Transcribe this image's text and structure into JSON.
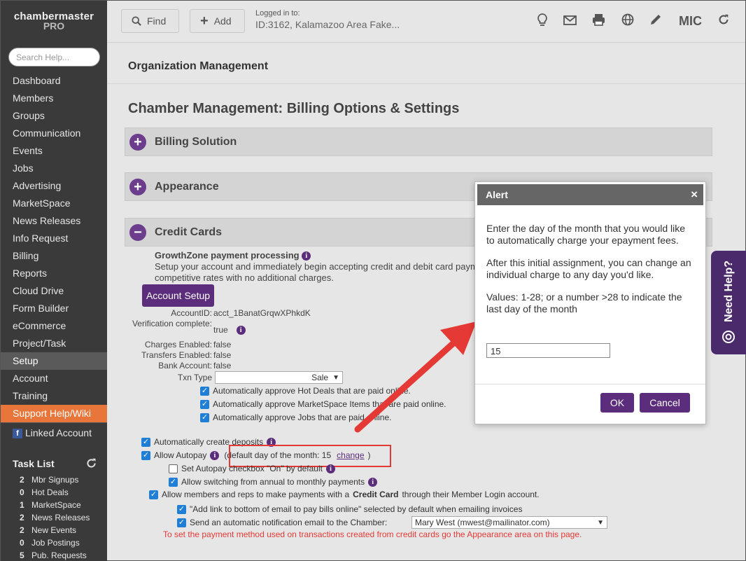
{
  "sidebar": {
    "logo_line1": "chambermaster",
    "logo_line2": "PRO",
    "search_placeholder": "Search Help...",
    "items": [
      {
        "label": "Dashboard"
      },
      {
        "label": "Members"
      },
      {
        "label": "Groups"
      },
      {
        "label": "Communication"
      },
      {
        "label": "Events"
      },
      {
        "label": "Jobs"
      },
      {
        "label": "Advertising"
      },
      {
        "label": "MarketSpace"
      },
      {
        "label": "News Releases"
      },
      {
        "label": "Info Request"
      },
      {
        "label": "Billing"
      },
      {
        "label": "Reports"
      },
      {
        "label": "Cloud Drive"
      },
      {
        "label": "Form Builder"
      },
      {
        "label": "eCommerce"
      },
      {
        "label": "Project/Task"
      },
      {
        "label": "Setup"
      },
      {
        "label": "Account"
      },
      {
        "label": "Training"
      },
      {
        "label": "Support Help/Wiki"
      }
    ],
    "linked_account": "Linked Account",
    "task_list_title": "Task List",
    "tasks": [
      {
        "count": "2",
        "label": "Mbr Signups"
      },
      {
        "count": "0",
        "label": "Hot Deals"
      },
      {
        "count": "1",
        "label": "MarketSpace"
      },
      {
        "count": "2",
        "label": "News Releases"
      },
      {
        "count": "2",
        "label": "New Events"
      },
      {
        "count": "0",
        "label": "Job Postings"
      },
      {
        "count": "5",
        "label": "Pub. Requests"
      }
    ]
  },
  "topbar": {
    "find_label": "Find",
    "add_label": "Add",
    "logged_in_label": "Logged in to:",
    "logged_in_value": "ID:3162, Kalamazoo Area Fake...",
    "mic_label": "MIC"
  },
  "main": {
    "org_title": "Organization Management",
    "page_title": "Chamber Management: Billing Options & Settings",
    "sections": [
      {
        "label": "Billing Solution",
        "icon": "+"
      },
      {
        "label": "Appearance",
        "icon": "+"
      },
      {
        "label": "Credit Cards",
        "icon": "−"
      }
    ],
    "gz_title": "GrowthZone payment processing",
    "gz_desc1": "Setup your account and immediately begin accepting credit and debit card payme",
    "gz_desc2": "competitive rates with no additional charges.",
    "account_setup_label": "Account Setup",
    "account_id_label": "AccountID:",
    "account_id_value": "acct_1BanatGrqwXPhkdK",
    "verification_label": "Verification complete:",
    "verification_value": "true",
    "charges_label": "Charges Enabled:",
    "charges_value": "false",
    "transfers_label": "Transfers Enabled:",
    "transfers_value": "false",
    "bank_label": "Bank Account:",
    "bank_value": "false",
    "txn_label": "Txn Type",
    "txn_value": "Sale",
    "approve_hot_deals": "Automatically approve Hot Deals that are paid online.",
    "approve_marketspace": "Automatically approve MarketSpace Items that are paid online.",
    "approve_jobs": "Automatically approve Jobs that are paid online.",
    "auto_deposits": "Automatically create deposits",
    "allow_autopay": "Allow Autopay",
    "default_day_text": "(default day of the month: 15",
    "change_link": "change",
    "default_day_close": ")",
    "set_autopay_default": "Set Autopay checkbox \"On\" by default",
    "allow_switching": "Allow switching from annual to monthly payments",
    "allow_members_pre": "Allow members and reps to make payments with a",
    "allow_members_bold": "Credit Card",
    "allow_members_post": "through their Member Login account.",
    "add_link_email": "\"Add link to bottom of email to pay bills online\" selected by default when emailing invoices",
    "send_notification": "Send an automatic notification email to the Chamber:",
    "notification_recipient": "Mary West (mwest@mailinator.com)",
    "red_note": "To set the payment method used on transactions created from credit cards go the Appearance area on this page."
  },
  "modal": {
    "title": "Alert",
    "close_glyph": "×",
    "para1": "Enter the day of the month that you would like to automatically charge your epayment fees.",
    "para2": "After this initial assignment, you can change an individual charge to any day you'd like.",
    "para3": "Values: 1-28; or a number >28 to indicate the last day of the month",
    "input_value": "15",
    "ok_label": "OK",
    "cancel_label": "Cancel"
  },
  "need_help_label": "Need Help?",
  "colors": {
    "purple": "#5b2d7c",
    "highlight_red": "#e53935",
    "sidebar": "#3a3a3a",
    "support": "#e8763a"
  }
}
